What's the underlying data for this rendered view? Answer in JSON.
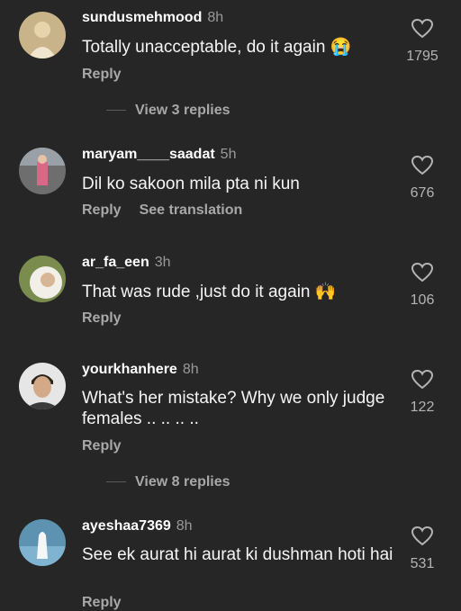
{
  "comments": [
    {
      "user": "sundusmehmood",
      "time": "8h",
      "text": "Totally unacceptable, do it again 😭",
      "actions": [
        "Reply"
      ],
      "likes": "1795",
      "view_replies": "View 3 replies",
      "avatar_icon": "person-avatar"
    },
    {
      "user": "maryam____saadat",
      "time": "5h",
      "text": "Dil ko sakoon mila pta ni kun",
      "actions": [
        "Reply",
        "See translation"
      ],
      "likes": "676",
      "avatar_icon": "person-avatar"
    },
    {
      "user": "ar_fa_een",
      "time": "3h",
      "text": "That was rude ,just  do it again 🙌",
      "actions": [
        "Reply"
      ],
      "likes": "106",
      "avatar_icon": "person-avatar"
    },
    {
      "user": "yourkhanhere",
      "time": "8h",
      "text": "What's her mistake? Why we only judge females .. .. .. ..",
      "actions": [
        "Reply"
      ],
      "likes": "122",
      "view_replies": "View 8 replies",
      "avatar_icon": "person-avatar"
    },
    {
      "user": "ayeshaa7369",
      "time": "8h",
      "text": "See ek aurat hi aurat ki dushman hoti hai",
      "actions": [
        "Reply"
      ],
      "likes": "531",
      "avatar_icon": "person-avatar"
    }
  ],
  "colors": {
    "background": "#262626",
    "text": "#f5f5f5",
    "muted": "#a8a8a8"
  }
}
